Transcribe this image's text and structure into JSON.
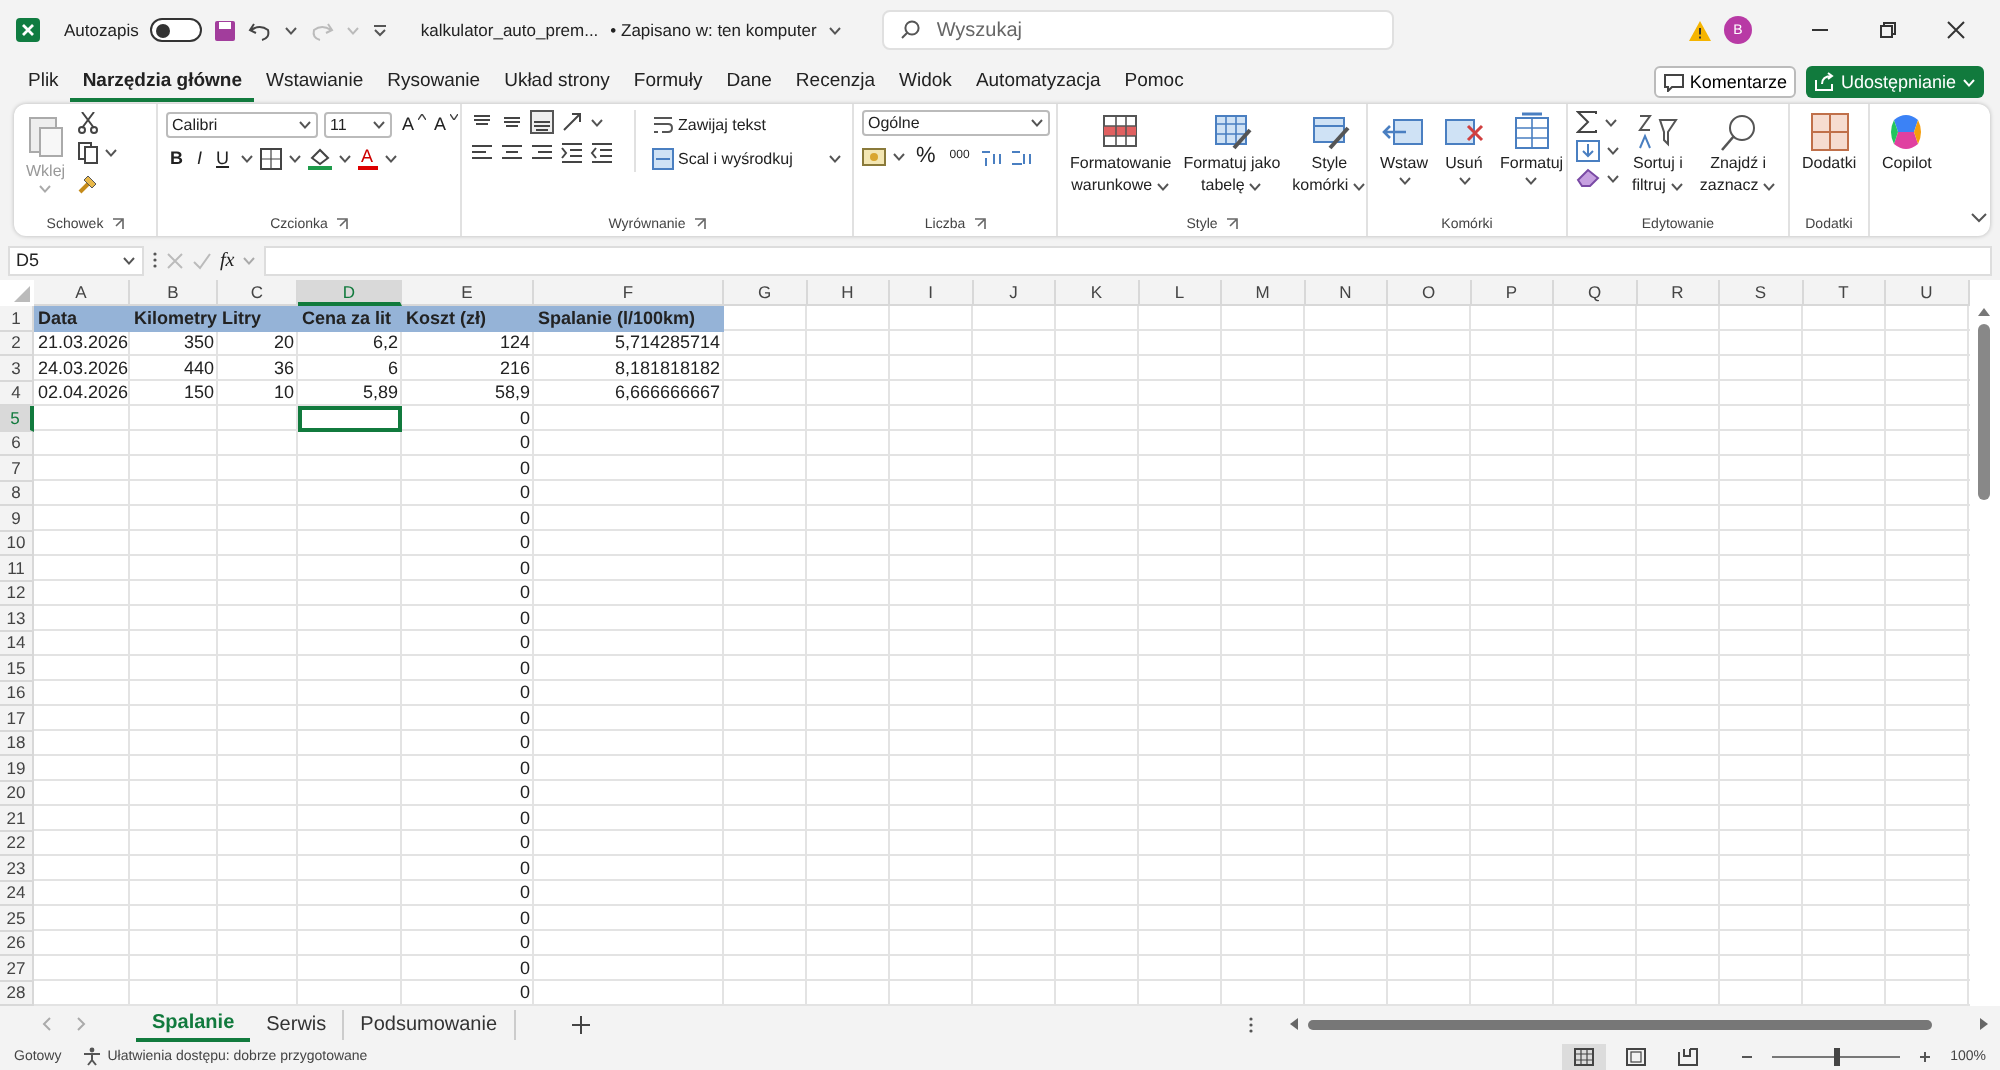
{
  "title_bar": {
    "autosave_label": "Autozapis",
    "autosave_on": false,
    "file_name": "kalkulator_auto_prem...",
    "save_status": "• Zapisano w: ten komputer",
    "search_placeholder": "Wyszukaj",
    "avatar": "B"
  },
  "menu_tabs": [
    {
      "label": "Plik",
      "selected": false
    },
    {
      "label": "Narzędzia główne",
      "selected": true
    },
    {
      "label": "Wstawianie",
      "selected": false
    },
    {
      "label": "Rysowanie",
      "selected": false
    },
    {
      "label": "Układ strony",
      "selected": false
    },
    {
      "label": "Formuły",
      "selected": false
    },
    {
      "label": "Dane",
      "selected": false
    },
    {
      "label": "Recenzja",
      "selected": false
    },
    {
      "label": "Widok",
      "selected": false
    },
    {
      "label": "Automatyzacja",
      "selected": false
    },
    {
      "label": "Pomoc",
      "selected": false
    }
  ],
  "comments_button": "Komentarze",
  "share_button": "Udostępnianie",
  "ribbon": {
    "clipboard": {
      "paste_label": "Wklej",
      "paste_disabled": true,
      "group_label": "Schowek"
    },
    "font": {
      "family": "Calibri",
      "size": "11",
      "grow": "A",
      "shrink": "A",
      "bold": "B",
      "italic": "I",
      "underline": "U",
      "font_color": "A",
      "group_label": "Czcionka"
    },
    "alignment": {
      "wrap_text": "Zawijaj tekst",
      "merge_center": "Scal i wyśrodkuj",
      "group_label": "Wyrównanie"
    },
    "number": {
      "format": "Ogólne",
      "percent": "%",
      "thousands": "000",
      "group_label": "Liczba"
    },
    "styles": {
      "buttons": [
        [
          "Formatowanie",
          "warunkowe"
        ],
        [
          "Formatuj jako",
          "tabelę"
        ],
        [
          "Style",
          "komórki"
        ]
      ],
      "group_label": "Style"
    },
    "cells": {
      "buttons": [
        "Wstaw",
        "Usuń",
        "Formatuj"
      ],
      "group_label": "Komórki"
    },
    "editing": {
      "buttons": [
        [
          "Sortuj i",
          "filtruj"
        ],
        [
          "Znajdź i",
          "zaznacz"
        ]
      ],
      "group_label": "Edytowanie"
    },
    "addins": {
      "button": "Dodatki",
      "group_label": "Dodatki"
    },
    "copilot": {
      "button": "Copilot"
    }
  },
  "formula_bar": {
    "name_box": "D5",
    "function_label": "fx"
  },
  "sheet": {
    "columns": [
      {
        "label": "A",
        "selected": false
      },
      {
        "label": "B",
        "selected": false
      },
      {
        "label": "C",
        "selected": false
      },
      {
        "label": "D",
        "selected": true
      },
      {
        "label": "E",
        "selected": false
      },
      {
        "label": "F",
        "selected": false
      },
      {
        "label": "G",
        "selected": false
      },
      {
        "label": "H",
        "selected": false
      },
      {
        "label": "I",
        "selected": false
      },
      {
        "label": "J",
        "selected": false
      },
      {
        "label": "K",
        "selected": false
      },
      {
        "label": "L",
        "selected": false
      },
      {
        "label": "M",
        "selected": false
      },
      {
        "label": "N",
        "selected": false
      },
      {
        "label": "O",
        "selected": false
      },
      {
        "label": "P",
        "selected": false
      },
      {
        "label": "Q",
        "selected": false
      },
      {
        "label": "R",
        "selected": false
      },
      {
        "label": "S",
        "selected": false
      },
      {
        "label": "T",
        "selected": false
      },
      {
        "label": "U",
        "selected": false
      }
    ],
    "rows": [
      {
        "number": "1",
        "selected": false,
        "kind": "header",
        "cells": [
          {
            "text": "Data",
            "kind": "text"
          },
          {
            "text": "Kilometry",
            "kind": "text"
          },
          {
            "text": "Litry",
            "kind": "text"
          },
          {
            "text": "Cena za lit",
            "kind": "text"
          },
          {
            "text": "Koszt (zł)",
            "kind": "text"
          },
          {
            "text": "Spalanie (l/100km)",
            "kind": "text"
          }
        ]
      },
      {
        "number": "2",
        "selected": false,
        "kind": "data",
        "cells": [
          {
            "text": "21.03.2026",
            "kind": "text"
          },
          {
            "text": "350",
            "kind": "number"
          },
          {
            "text": "20",
            "kind": "number"
          },
          {
            "text": "6,2",
            "kind": "number"
          },
          {
            "text": "124",
            "kind": "number"
          },
          {
            "text": "5,714285714",
            "kind": "number"
          }
        ]
      },
      {
        "number": "3",
        "selected": false,
        "kind": "data",
        "cells": [
          {
            "text": "24.03.2026",
            "kind": "text"
          },
          {
            "text": "440",
            "kind": "number"
          },
          {
            "text": "36",
            "kind": "number"
          },
          {
            "text": "6",
            "kind": "number"
          },
          {
            "text": "216",
            "kind": "number"
          },
          {
            "text": "8,181818182",
            "kind": "number"
          }
        ]
      },
      {
        "number": "4",
        "selected": false,
        "kind": "data",
        "cells": [
          {
            "text": "02.04.2026",
            "kind": "text"
          },
          {
            "text": "150",
            "kind": "number"
          },
          {
            "text": "10",
            "kind": "number"
          },
          {
            "text": "5,89",
            "kind": "number"
          },
          {
            "text": "58,9",
            "kind": "number"
          },
          {
            "text": "6,666666667",
            "kind": "number"
          }
        ]
      },
      {
        "number": "5",
        "selected": true,
        "kind": "data",
        "cells": [
          null,
          null,
          null,
          null,
          {
            "text": "0",
            "kind": "number"
          }
        ]
      },
      {
        "number": "6",
        "selected": false,
        "kind": "data",
        "cells": [
          null,
          null,
          null,
          null,
          {
            "text": "0",
            "kind": "number"
          }
        ]
      },
      {
        "number": "7",
        "selected": false,
        "kind": "data",
        "cells": [
          null,
          null,
          null,
          null,
          {
            "text": "0",
            "kind": "number"
          }
        ]
      },
      {
        "number": "8",
        "selected": false,
        "kind": "data",
        "cells": [
          null,
          null,
          null,
          null,
          {
            "text": "0",
            "kind": "number"
          }
        ]
      },
      {
        "number": "9",
        "selected": false,
        "kind": "data",
        "cells": [
          null,
          null,
          null,
          null,
          {
            "text": "0",
            "kind": "number"
          }
        ]
      },
      {
        "number": "10",
        "selected": false,
        "kind": "data",
        "cells": [
          null,
          null,
          null,
          null,
          {
            "text": "0",
            "kind": "number"
          }
        ]
      },
      {
        "number": "11",
        "selected": false,
        "kind": "data",
        "cells": [
          null,
          null,
          null,
          null,
          {
            "text": "0",
            "kind": "number"
          }
        ]
      },
      {
        "number": "12",
        "selected": false,
        "kind": "data",
        "cells": [
          null,
          null,
          null,
          null,
          {
            "text": "0",
            "kind": "number"
          }
        ]
      },
      {
        "number": "13",
        "selected": false,
        "kind": "data",
        "cells": [
          null,
          null,
          null,
          null,
          {
            "text": "0",
            "kind": "number"
          }
        ]
      },
      {
        "number": "14",
        "selected": false,
        "kind": "data",
        "cells": [
          null,
          null,
          null,
          null,
          {
            "text": "0",
            "kind": "number"
          }
        ]
      },
      {
        "number": "15",
        "selected": false,
        "kind": "data",
        "cells": [
          null,
          null,
          null,
          null,
          {
            "text": "0",
            "kind": "number"
          }
        ]
      },
      {
        "number": "16",
        "selected": false,
        "kind": "data",
        "cells": [
          null,
          null,
          null,
          null,
          {
            "text": "0",
            "kind": "number"
          }
        ]
      },
      {
        "number": "17",
        "selected": false,
        "kind": "data",
        "cells": [
          null,
          null,
          null,
          null,
          {
            "text": "0",
            "kind": "number"
          }
        ]
      },
      {
        "number": "18",
        "selected": false,
        "kind": "data",
        "cells": [
          null,
          null,
          null,
          null,
          {
            "text": "0",
            "kind": "number"
          }
        ]
      },
      {
        "number": "19",
        "selected": false,
        "kind": "data",
        "cells": [
          null,
          null,
          null,
          null,
          {
            "text": "0",
            "kind": "number"
          }
        ]
      },
      {
        "number": "20",
        "selected": false,
        "kind": "data",
        "cells": [
          null,
          null,
          null,
          null,
          {
            "text": "0",
            "kind": "number"
          }
        ]
      },
      {
        "number": "21",
        "selected": false,
        "kind": "data",
        "cells": [
          null,
          null,
          null,
          null,
          {
            "text": "0",
            "kind": "number"
          }
        ]
      },
      {
        "number": "22",
        "selected": false,
        "kind": "data",
        "cells": [
          null,
          null,
          null,
          null,
          {
            "text": "0",
            "kind": "number"
          }
        ]
      },
      {
        "number": "23",
        "selected": false,
        "kind": "data",
        "cells": [
          null,
          null,
          null,
          null,
          {
            "text": "0",
            "kind": "number"
          }
        ]
      },
      {
        "number": "24",
        "selected": false,
        "kind": "data",
        "cells": [
          null,
          null,
          null,
          null,
          {
            "text": "0",
            "kind": "number"
          }
        ]
      },
      {
        "number": "25",
        "selected": false,
        "kind": "data",
        "cells": [
          null,
          null,
          null,
          null,
          {
            "text": "0",
            "kind": "number"
          }
        ]
      },
      {
        "number": "26",
        "selected": false,
        "kind": "data",
        "cells": [
          null,
          null,
          null,
          null,
          {
            "text": "0",
            "kind": "number"
          }
        ]
      },
      {
        "number": "27",
        "selected": false,
        "kind": "data",
        "cells": [
          null,
          null,
          null,
          null,
          {
            "text": "0",
            "kind": "number"
          }
        ]
      },
      {
        "number": "28",
        "selected": false,
        "kind": "data",
        "cells": [
          null,
          null,
          null,
          null,
          {
            "text": "0",
            "kind": "number"
          }
        ]
      }
    ]
  },
  "sheet_tabs": [
    {
      "label": "Spalanie",
      "selected": true
    },
    {
      "label": "Serwis",
      "selected": false
    },
    {
      "label": "Podsumowanie",
      "selected": false
    }
  ],
  "status_bar": {
    "ready": "Gotowy",
    "accessibility": "Ułatwienia dostępu: dobrze przygotowane",
    "views": [
      {
        "kind": "normal",
        "selected": true
      },
      {
        "kind": "page-layout",
        "selected": false
      },
      {
        "kind": "page-break",
        "selected": false
      }
    ],
    "zoom": {
      "level": 0.5,
      "label": "100%"
    }
  }
}
